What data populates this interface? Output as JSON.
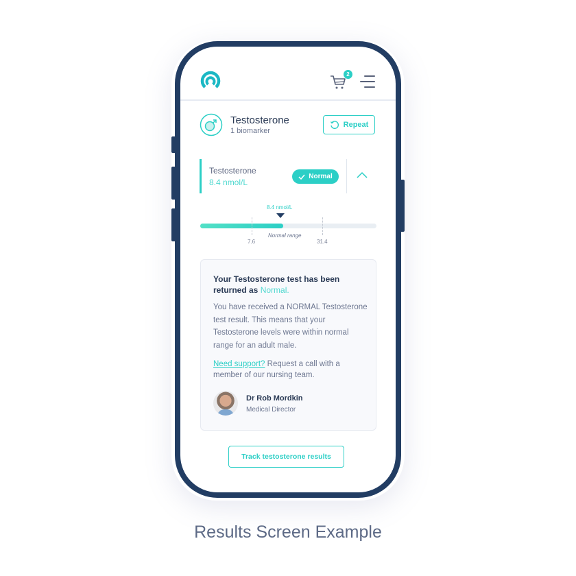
{
  "header": {
    "logo_icon": "signal-ring-logo",
    "cart_icon": "shopping-cart-icon",
    "cart_count": "2",
    "menu_icon": "hamburger-menu-icon"
  },
  "section": {
    "icon": "male-symbol-icon",
    "title": "Testosterone",
    "subtitle": "1 biomarker",
    "repeat_label": "Repeat"
  },
  "biomarker": {
    "name": "Testosterone",
    "value": "8.4 nmol/L",
    "status": "Normal",
    "expanded": true
  },
  "range": {
    "value_label": "8.4 nmol/L",
    "value": 8.4,
    "low_label": "7.6",
    "high_label": "31.4",
    "caption": "Normal range"
  },
  "result_card": {
    "title_prefix": "Your Testosterone test has been returned as ",
    "title_status": "Normal.",
    "body": "You have received a NORMAL Testosterone test result. This means that your Testosterone levels were within normal range for an adult male.",
    "support_link": "Need support?",
    "support_text": " Request a call with a member of our nursing team.",
    "doctor_name": "Dr Rob Mordkin",
    "doctor_role": "Medical Director"
  },
  "track_button_label": "Track testosterone results",
  "caption": "Results Screen Example",
  "colors": {
    "accent": "#2ccfc6",
    "frame": "#223d63",
    "text_dark": "#2a3a55",
    "text_muted": "#6c7690"
  }
}
